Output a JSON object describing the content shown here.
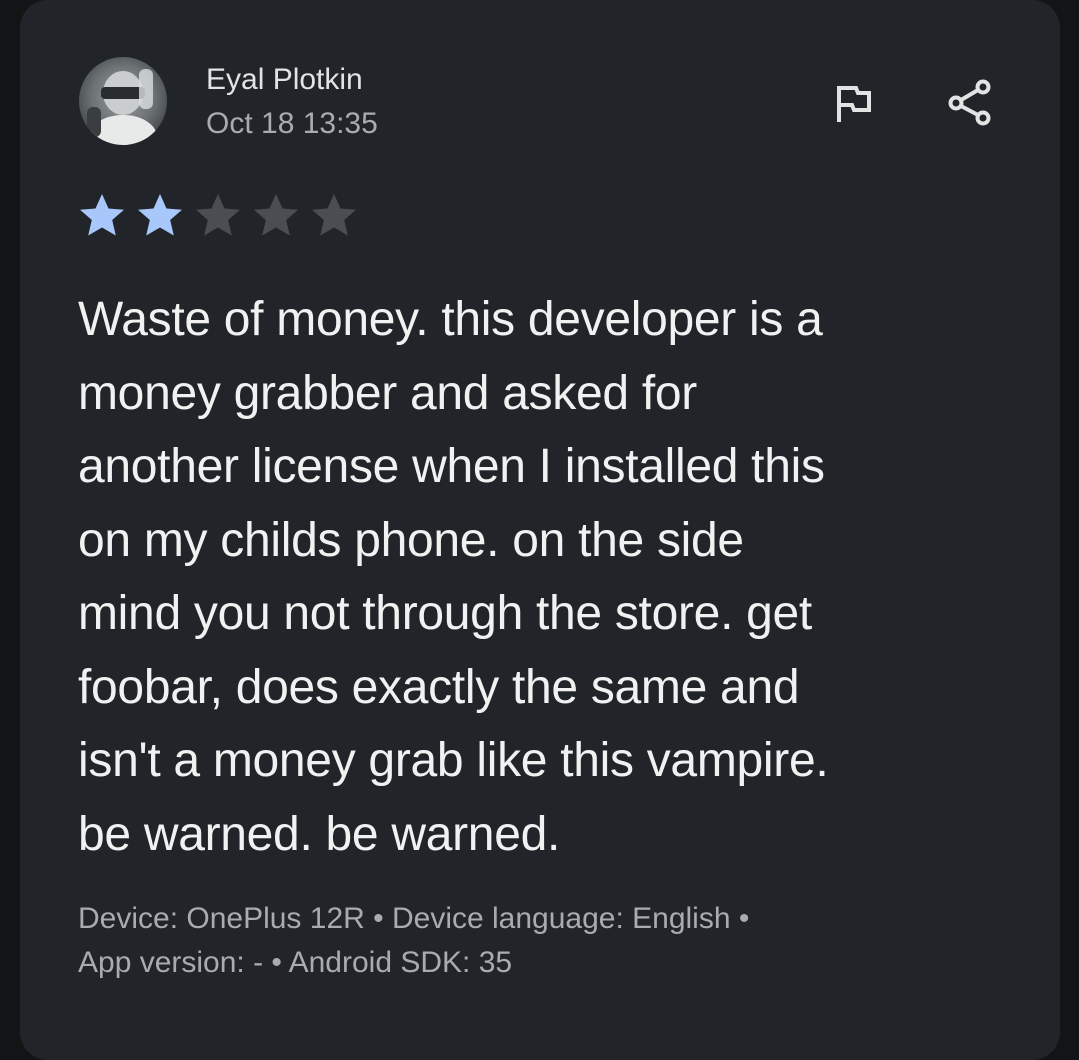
{
  "review": {
    "author_name": "Eyal Plotkin",
    "date": "Oct 18 13:35",
    "rating": 2,
    "max_rating": 5,
    "text_lines": [
      "Waste of money. this developer is a",
      "money grabber and asked for",
      "another license when I installed this",
      "on my childs phone. on the side",
      "mind you not through the store. get",
      "foobar, does exactly the same and",
      "isn't a money grab like this vampire.",
      "be warned. be warned."
    ],
    "device_line": "Device: OnePlus 12R • Device language: English •",
    "app_line": "App version: - • Android SDK: 35"
  },
  "icons": {
    "flag": "flag-icon",
    "share": "share-icon",
    "avatar": "avatar"
  },
  "colors": {
    "card_background": "#212529",
    "star_filled": "#a8c7fa",
    "star_empty": "#4a4d51",
    "primary_text": "#f1f1f1",
    "secondary_text": "#a9abae"
  }
}
